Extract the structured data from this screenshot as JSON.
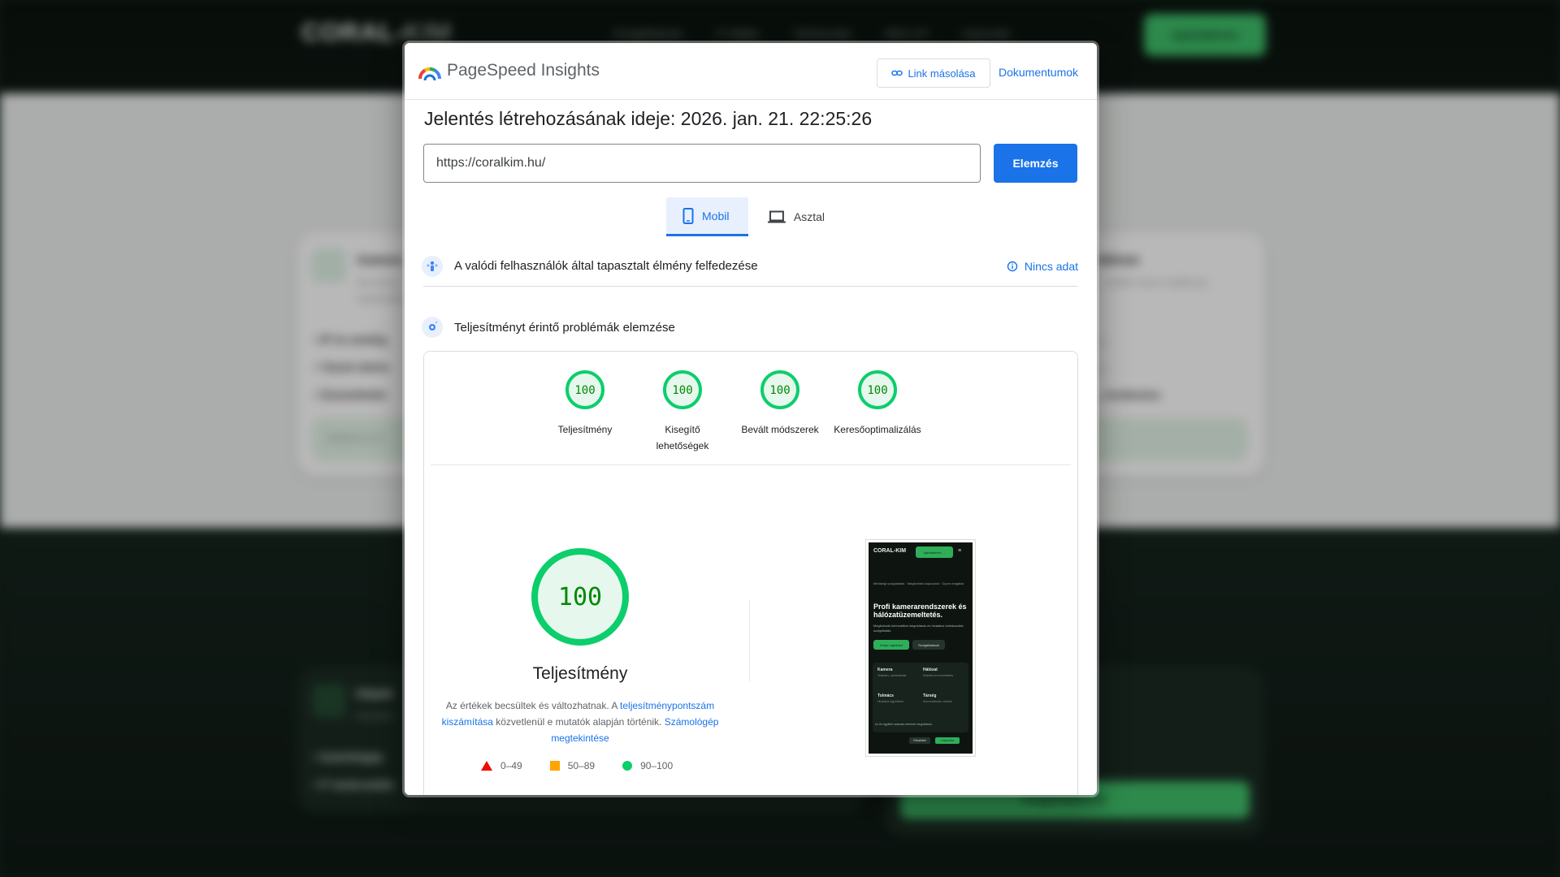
{
  "background": {
    "logo_main": "CORAL-",
    "logo_accent": "KIM",
    "nav": [
      "Szolgáltatások",
      "IT ellátás",
      "Tolmácsolás",
      "Miért mi?",
      "Kapcsolat"
    ],
    "cta": "Ajánlatkérés",
    "card1": {
      "title": "Kamera",
      "text1": "Ne bízza",
      "text2": "tapasztalt",
      "bullets": [
        "IP és analóg",
        "Távoli elérés",
        "Üzemeltetés"
      ],
      "pill": "Átláthat és k"
    },
    "card2": {
      "title": "Hálózat",
      "text1": "... nélkül nincs hatékony",
      "bullets": [
        "...",
        "...",
        "...rendezése"
      ]
    },
    "card3": {
      "title": "Gépek",
      "text1": "Hardver",
      "bullets": [
        "Számítógép",
        "IT tanácsadás"
      ]
    },
    "card4": {
      "button": "Árajánlatkérés"
    }
  },
  "topbar": {
    "title": "PageSpeed Insights",
    "copy_link": "Link másolása",
    "docs": "Dokumentumok"
  },
  "report": {
    "time": "Jelentés létrehozásának ideje: 2026. jan. 21. 22:25:26",
    "url": "https://coralkim.hu/",
    "analyze": "Elemzés"
  },
  "tabs": {
    "mobile": "Mobil",
    "desktop": "Asztal"
  },
  "sections": {
    "field": "A valódi felhasználók által tapasztalt élmény felfedezése",
    "no_data": "Nincs adat",
    "lab": "Teljesítményt érintő problémák elemzése"
  },
  "scores": [
    {
      "value": "100",
      "label": "Teljesítmény"
    },
    {
      "value": "100",
      "label": "Kisegítő lehetőségek"
    },
    {
      "value": "100",
      "label": "Bevált módszerek"
    },
    {
      "value": "100",
      "label": "Keresőoptimalizálás"
    }
  ],
  "main_score": {
    "value": "100",
    "label": "Teljesítmény",
    "desc_pre": "Az értékek becsültek és változhatnak. A ",
    "desc_link1": "teljesítménypontszám kiszámítása",
    "desc_mid": " közvetlenül e mutatók alapján történik. ",
    "desc_link2": "Számológép megtekintése"
  },
  "legend": {
    "fail": "0–49",
    "average": "50–89",
    "pass": "90–100"
  },
  "colors": {
    "pass": "#0cce6b",
    "pass_bg": "#e6f8ee",
    "pass_text": "#008800",
    "accent": "#1a73e8"
  },
  "screenshot": {
    "logo": "CORAL-KIM",
    "cta": "Ajánlatkérés →",
    "menu": "≡",
    "badge": "Minőségi szolgáltatás · Megbízható kapcsolat · Gyors reagálás",
    "headline": "Profi kamerarendszerek és hálózatüzemeltetés.",
    "para": "Megbízható informatikai megoldások és hivatalos tolmácsolási szolgáltatás.",
    "btn1": "Kérjen ajánlatot",
    "btn2": "Szolgáltatások",
    "cells": [
      {
        "title": "Kamera",
        "sub": "Telepítés, karbantartás"
      },
      {
        "title": "Hálózat",
        "sub": "Kiépítés és üzemeltetés"
      },
      {
        "title": "Tolmács",
        "sub": "Hivatalos ügyintézés"
      },
      {
        "title": "Társég",
        "sub": "Szervertárolás, mentés"
      }
    ],
    "foot": "Az ön ügyfélei számára elérhető megoldások.",
    "fbtn1": "Részletek",
    "fbtn2": "Kapcsolat"
  }
}
